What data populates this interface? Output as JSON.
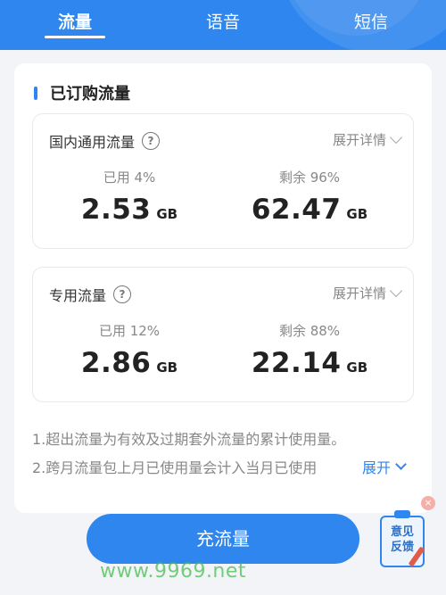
{
  "tabs": [
    {
      "label": "流量",
      "active": true
    },
    {
      "label": "语音",
      "active": false
    },
    {
      "label": "短信",
      "active": false
    }
  ],
  "section": {
    "title": "已订购流量"
  },
  "packages": [
    {
      "title": "国内通用流量",
      "help_icon": "question-circle-icon",
      "expand_label": "展开详情",
      "used_label": "已用 4%",
      "used_value": "2.53",
      "remaining_label": "剩余 96%",
      "remaining_value": "62.47",
      "unit": "GB",
      "used_percent": 4
    },
    {
      "title": "专用流量",
      "help_icon": "question-circle-icon",
      "expand_label": "展开详情",
      "used_label": "已用 12%",
      "used_value": "2.86",
      "remaining_label": "剩余 88%",
      "remaining_value": "22.14",
      "unit": "GB",
      "used_percent": 12
    }
  ],
  "notes": [
    "1.超出流量为有效及过期套外流量的累计使用量。",
    "2.跨月流量包上月已使用量会计入当月已使用"
  ],
  "notes_expand_label": "展开",
  "topup_button": "充流量",
  "feedback": {
    "label_line1": "意见",
    "label_line2": "反馈",
    "close": "×"
  },
  "watermark": "www.9969.net",
  "colors": {
    "accent": "#2f86ee",
    "background": "#f3f4f7"
  }
}
